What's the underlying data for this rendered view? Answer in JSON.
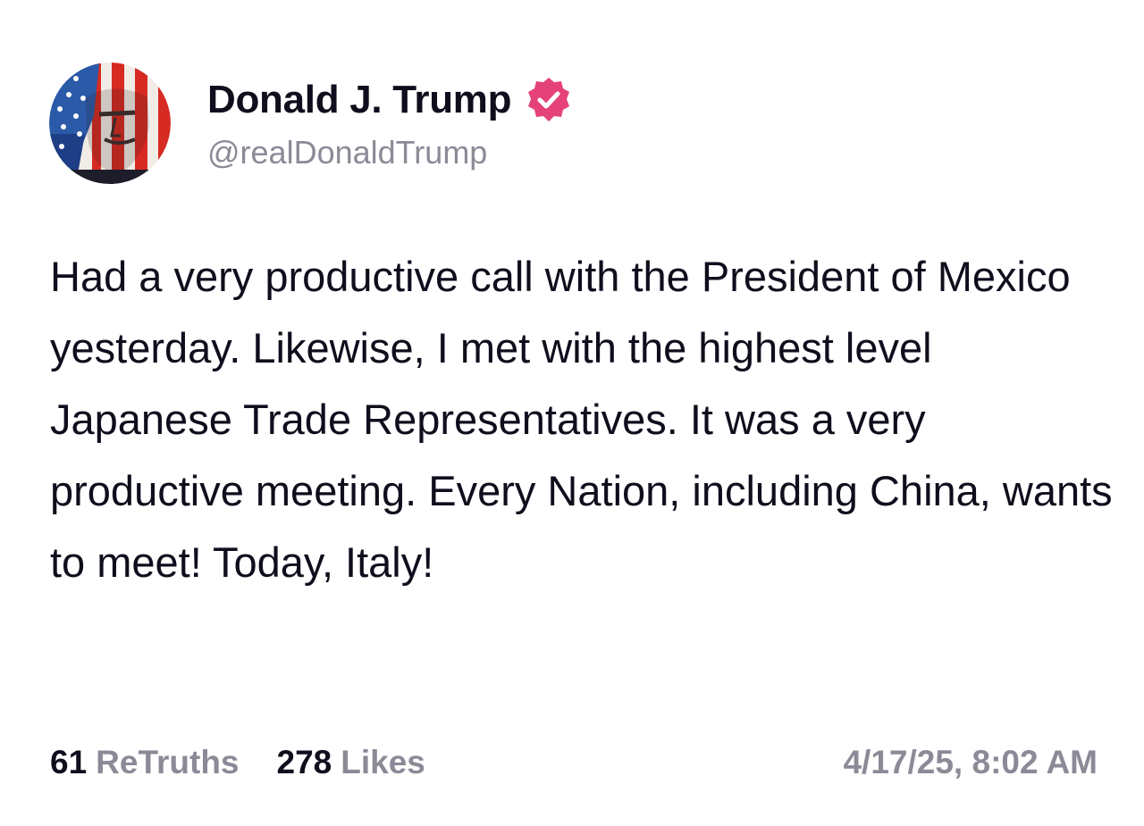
{
  "author": {
    "display_name": "Donald J. Trump",
    "handle": "@realDonaldTrump",
    "verified_icon": "verified-badge-icon",
    "verified_color": "#e5427a"
  },
  "post": {
    "text": "Had a very productive call with the President of Mexico yesterday. Likewise, I met with the highest level Japanese Trade Representatives. It was a very productive meeting. Every Nation, including China, wants to meet! Today, Italy!"
  },
  "stats": {
    "retruths_count": "61",
    "retruths_label": "ReTruths",
    "likes_count": "278",
    "likes_label": "Likes"
  },
  "timestamp": "4/17/25, 8:02 AM",
  "colors": {
    "text_primary": "#0f0e1d",
    "text_secondary": "#8c8a97"
  }
}
